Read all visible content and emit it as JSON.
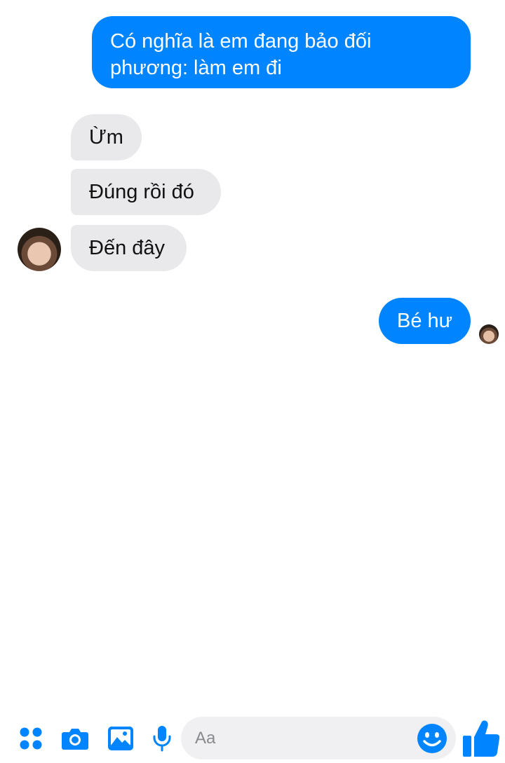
{
  "messages": [
    {
      "id": "msg-1",
      "sender": "me",
      "text": "Có nghĩa là em đang bảo đối phương: làm em đi"
    },
    {
      "id": "msg-2",
      "sender": "other",
      "text": "Ừm"
    },
    {
      "id": "msg-3",
      "sender": "other",
      "text": "Đúng rồi đó"
    },
    {
      "id": "msg-4",
      "sender": "other",
      "text": "Đến đây"
    },
    {
      "id": "msg-5",
      "sender": "me",
      "text": "Bé hư"
    }
  ],
  "composer": {
    "placeholder": "Aa",
    "tools": [
      "apps-grid-icon",
      "camera-icon",
      "image-icon",
      "microphone-icon"
    ],
    "emoji_icon": "smiley-emoji-icon",
    "send_icon": "thumbs-up-icon"
  },
  "colors": {
    "accent": "#0084ff",
    "incoming_bubble": "#e9e9eb",
    "composer_bg": "#f0f0f2"
  }
}
